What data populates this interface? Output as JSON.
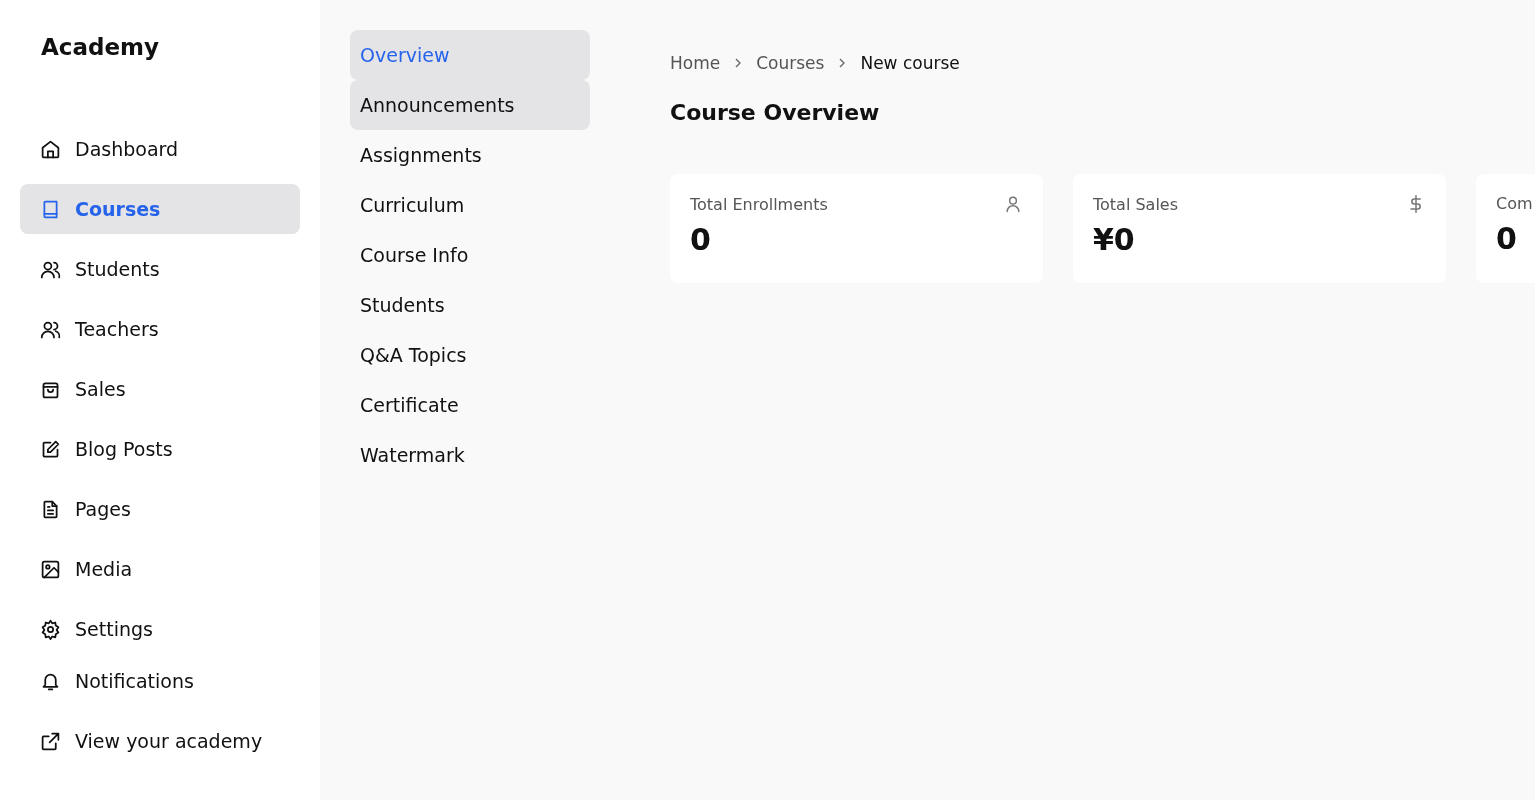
{
  "brand": "Academy",
  "sidebar": {
    "items": [
      {
        "label": "Dashboard",
        "selected": false
      },
      {
        "label": "Courses",
        "selected": true
      },
      {
        "label": "Students",
        "selected": false
      },
      {
        "label": "Teachers",
        "selected": false
      },
      {
        "label": "Sales",
        "selected": false
      },
      {
        "label": "Blog Posts",
        "selected": false
      },
      {
        "label": "Pages",
        "selected": false
      },
      {
        "label": "Media",
        "selected": false
      },
      {
        "label": "Settings",
        "selected": false
      },
      {
        "label": "Notifications",
        "selected": false
      },
      {
        "label": "View your academy",
        "selected": false
      }
    ]
  },
  "course_nav": {
    "items": [
      {
        "label": "Overview",
        "selected": true,
        "hovered": false
      },
      {
        "label": "Announcements",
        "selected": false,
        "hovered": true
      },
      {
        "label": "Assignments",
        "selected": false,
        "hovered": false
      },
      {
        "label": "Curriculum",
        "selected": false,
        "hovered": false
      },
      {
        "label": "Course Info",
        "selected": false,
        "hovered": false
      },
      {
        "label": "Students",
        "selected": false,
        "hovered": false
      },
      {
        "label": "Q&A Topics",
        "selected": false,
        "hovered": false
      },
      {
        "label": "Certificate",
        "selected": false,
        "hovered": false
      },
      {
        "label": "Watermark",
        "selected": false,
        "hovered": false
      }
    ]
  },
  "breadcrumb": [
    "Home",
    "Courses",
    "New course"
  ],
  "title": "Course Overview",
  "stats": [
    {
      "label": "Total Enrollments",
      "value": "0",
      "kind": "person"
    },
    {
      "label": "Total Sales",
      "value": "¥0",
      "kind": "dollar"
    },
    {
      "label": "Com",
      "value": "0",
      "kind": "none"
    }
  ]
}
